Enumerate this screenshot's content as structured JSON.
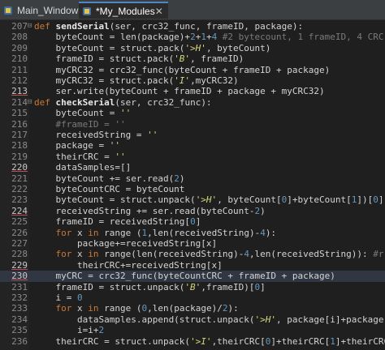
{
  "tabs": [
    {
      "label": "Main_Window",
      "active": false
    },
    {
      "label": "*My_Modules",
      "active": true
    }
  ],
  "close_glyph": "✕",
  "lines": [
    {
      "n": "207",
      "fold": "⊟",
      "cur": false,
      "bp": false,
      "tokens": [
        [
          "kw",
          "def "
        ],
        [
          "fn",
          "sendSerial"
        ],
        [
          "t",
          "(ser, crc32_func, frameID, package):"
        ]
      ]
    },
    {
      "n": "208",
      "fold": "",
      "cur": false,
      "bp": false,
      "tokens": [
        [
          "t",
          "    byteCount = len(package)+"
        ],
        [
          "num",
          "2"
        ],
        [
          "t",
          "+"
        ],
        [
          "num",
          "1"
        ],
        [
          "t",
          "+"
        ],
        [
          "num",
          "4"
        ],
        [
          "cm",
          " #2 bytecount, 1 frameID, 4 CRC"
        ]
      ]
    },
    {
      "n": "209",
      "fold": "",
      "cur": false,
      "bp": false,
      "tokens": [
        [
          "t",
          "    byteCount = struct.pack("
        ],
        [
          "str",
          "'>H'"
        ],
        [
          "t",
          ", byteCount)"
        ]
      ]
    },
    {
      "n": "210",
      "fold": "",
      "cur": false,
      "bp": false,
      "tokens": [
        [
          "t",
          "    frameID = struct.pack("
        ],
        [
          "str",
          "'B'"
        ],
        [
          "t",
          ", frameID)"
        ]
      ]
    },
    {
      "n": "211",
      "fold": "",
      "cur": false,
      "bp": false,
      "tokens": [
        [
          "t",
          "    myCRC32 = crc32_func(byteCount + frameID + package)"
        ]
      ]
    },
    {
      "n": "212",
      "fold": "",
      "cur": false,
      "bp": false,
      "tokens": [
        [
          "t",
          "    myCRC32 = struct.pack("
        ],
        [
          "str",
          "'I'"
        ],
        [
          "t",
          ",myCRC32)"
        ]
      ]
    },
    {
      "n": "213",
      "fold": "",
      "cur": false,
      "bp": true,
      "tokens": [
        [
          "t",
          "    ser.write(byteCount + frameID + package + myCRC32)"
        ]
      ]
    },
    {
      "n": "214",
      "fold": "⊟",
      "cur": false,
      "bp": false,
      "tokens": [
        [
          "kw",
          "def "
        ],
        [
          "fn",
          "checkSerial"
        ],
        [
          "t",
          "(ser, crc32_func):"
        ]
      ]
    },
    {
      "n": "215",
      "fold": "",
      "cur": false,
      "bp": false,
      "tokens": [
        [
          "t",
          "    byteCount = "
        ],
        [
          "str",
          "''"
        ]
      ]
    },
    {
      "n": "216",
      "fold": "",
      "cur": false,
      "bp": false,
      "tokens": [
        [
          "cm",
          "    #frameID = ''"
        ]
      ]
    },
    {
      "n": "217",
      "fold": "",
      "cur": false,
      "bp": false,
      "tokens": [
        [
          "t",
          "    receivedString = "
        ],
        [
          "str",
          "''"
        ]
      ]
    },
    {
      "n": "218",
      "fold": "",
      "cur": false,
      "bp": false,
      "tokens": [
        [
          "t",
          "    package = "
        ],
        [
          "str",
          "''"
        ]
      ]
    },
    {
      "n": "219",
      "fold": "",
      "cur": false,
      "bp": false,
      "tokens": [
        [
          "t",
          "    theirCRC = "
        ],
        [
          "str",
          "''"
        ]
      ]
    },
    {
      "n": "220",
      "fold": "",
      "cur": false,
      "bp": true,
      "tokens": [
        [
          "t",
          "    dataSamples=[]"
        ]
      ]
    },
    {
      "n": "221",
      "fold": "",
      "cur": false,
      "bp": false,
      "tokens": [
        [
          "t",
          "    byteCount += ser.read("
        ],
        [
          "num",
          "2"
        ],
        [
          "t",
          ")"
        ]
      ]
    },
    {
      "n": "222",
      "fold": "",
      "cur": false,
      "bp": false,
      "tokens": [
        [
          "t",
          "    byteCountCRC = byteCount"
        ]
      ]
    },
    {
      "n": "223",
      "fold": "",
      "cur": false,
      "bp": false,
      "tokens": [
        [
          "t",
          "    byteCount = struct.unpack("
        ],
        [
          "str",
          "'>H'"
        ],
        [
          "t",
          ", byteCount["
        ],
        [
          "num",
          "0"
        ],
        [
          "t",
          "]+byteCount["
        ],
        [
          "num",
          "1"
        ],
        [
          "t",
          "])["
        ],
        [
          "num",
          "0"
        ],
        [
          "t",
          "]"
        ]
      ]
    },
    {
      "n": "224",
      "fold": "",
      "cur": false,
      "bp": true,
      "tokens": [
        [
          "t",
          "    receivedString += ser.read(byteCount-"
        ],
        [
          "num",
          "2"
        ],
        [
          "t",
          ")"
        ]
      ]
    },
    {
      "n": "225",
      "fold": "",
      "cur": false,
      "bp": false,
      "tokens": [
        [
          "t",
          "    frameID = receivedString["
        ],
        [
          "num",
          "0"
        ],
        [
          "t",
          "]"
        ]
      ]
    },
    {
      "n": "226",
      "fold": "",
      "cur": false,
      "bp": false,
      "tokens": [
        [
          "t",
          "    "
        ],
        [
          "kw",
          "for "
        ],
        [
          "t",
          "x "
        ],
        [
          "kw",
          "in "
        ],
        [
          "t",
          "range ("
        ],
        [
          "num",
          "1"
        ],
        [
          "t",
          ",len(receivedString)-"
        ],
        [
          "num",
          "4"
        ],
        [
          "t",
          "):"
        ]
      ]
    },
    {
      "n": "227",
      "fold": "",
      "cur": false,
      "bp": false,
      "tokens": [
        [
          "t",
          "        package+=receivedString[x]"
        ]
      ]
    },
    {
      "n": "228",
      "fold": "",
      "cur": false,
      "bp": false,
      "tokens": [
        [
          "t",
          "    "
        ],
        [
          "kw",
          "for "
        ],
        [
          "t",
          "x "
        ],
        [
          "kw",
          "in "
        ],
        [
          "t",
          "range(len(receivedString)-"
        ],
        [
          "num",
          "4"
        ],
        [
          "t",
          ",len(receivedString)): "
        ],
        [
          "cm",
          "#r"
        ]
      ]
    },
    {
      "n": "229",
      "fold": "",
      "cur": false,
      "bp": true,
      "tokens": [
        [
          "t",
          "        theirCRC+=receivedString[x]"
        ]
      ]
    },
    {
      "n": "230",
      "fold": "",
      "cur": true,
      "bp": true,
      "tokens": [
        [
          "t",
          "    myCRC = crc32_func(byteCountCRC + frameID + package)"
        ]
      ]
    },
    {
      "n": "231",
      "fold": "",
      "cur": false,
      "bp": false,
      "tokens": [
        [
          "t",
          "    frameID = struct.unpack("
        ],
        [
          "str",
          "'B'"
        ],
        [
          "t",
          ",frameID)["
        ],
        [
          "num",
          "0"
        ],
        [
          "t",
          "]"
        ]
      ]
    },
    {
      "n": "232",
      "fold": "",
      "cur": false,
      "bp": false,
      "tokens": [
        [
          "t",
          "    i = "
        ],
        [
          "num",
          "0"
        ]
      ]
    },
    {
      "n": "233",
      "fold": "",
      "cur": false,
      "bp": false,
      "tokens": [
        [
          "t",
          "    "
        ],
        [
          "kw",
          "for "
        ],
        [
          "t",
          "x "
        ],
        [
          "kw",
          "in "
        ],
        [
          "t",
          "range ("
        ],
        [
          "num",
          "0"
        ],
        [
          "t",
          ",len(package)/"
        ],
        [
          "num",
          "2"
        ],
        [
          "t",
          "):"
        ]
      ]
    },
    {
      "n": "234",
      "fold": "",
      "cur": false,
      "bp": false,
      "tokens": [
        [
          "t",
          "        dataSamples.append(struct.unpack("
        ],
        [
          "str",
          "'>H'"
        ],
        [
          "t",
          ", package[i]+package"
        ]
      ]
    },
    {
      "n": "235",
      "fold": "",
      "cur": false,
      "bp": false,
      "tokens": [
        [
          "t",
          "        i=i+"
        ],
        [
          "num",
          "2"
        ]
      ]
    },
    {
      "n": "236",
      "fold": "",
      "cur": false,
      "bp": false,
      "tokens": [
        [
          "t",
          "    theirCRC = struct.unpack("
        ],
        [
          "str",
          "'>I'"
        ],
        [
          "t",
          ",theirCRC["
        ],
        [
          "num",
          "0"
        ],
        [
          "t",
          "]+theirCRC["
        ],
        [
          "num",
          "1"
        ],
        [
          "t",
          "]+theirCRC"
        ]
      ]
    }
  ]
}
